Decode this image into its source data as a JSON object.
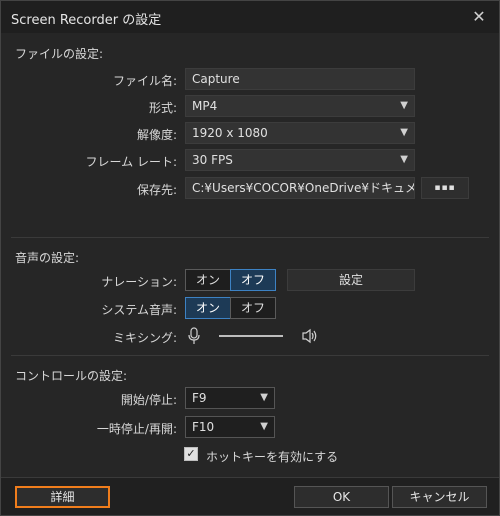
{
  "window": {
    "title": "Screen Recorder の設定",
    "close_glyph": "✕"
  },
  "file_section": {
    "title": "ファイルの設定:",
    "filename_label": "ファイル名:",
    "filename_value": "Capture",
    "format_label": "形式:",
    "format_value": "MP4",
    "resolution_label": "解像度:",
    "resolution_value": "1920 x 1080",
    "framerate_label": "フレーム レート:",
    "framerate_value": "30 FPS",
    "save_label": "保存先:",
    "save_path": "C:¥Users¥COCOR¥OneDrive¥ドキュメント",
    "browse_label": "▪▪▪"
  },
  "audio_section": {
    "title": "音声の設定:",
    "narration_label": "ナレーション:",
    "narration_on": "オン",
    "narration_off": "オフ",
    "narration_selected": "off",
    "settings_label": "設定",
    "system_label": "システム音声:",
    "system_on": "オン",
    "system_off": "オフ",
    "system_selected": "on",
    "mixing_label": "ミキシング:"
  },
  "control_section": {
    "title": "コントロールの設定:",
    "startstop_label": "開始/停止:",
    "startstop_value": "F9",
    "pause_label": "一時停止/再開:",
    "pause_value": "F10",
    "hotkey_label": "ホットキーを有効にする",
    "hotkey_checked": true
  },
  "footer": {
    "details_label": "詳細",
    "ok_label": "OK",
    "cancel_label": "キャンセル"
  },
  "colors": {
    "accent_blue": "#3d82c4",
    "highlight_orange": "#f07d1c"
  },
  "icons": {
    "caret": "▼",
    "check": "✓"
  }
}
